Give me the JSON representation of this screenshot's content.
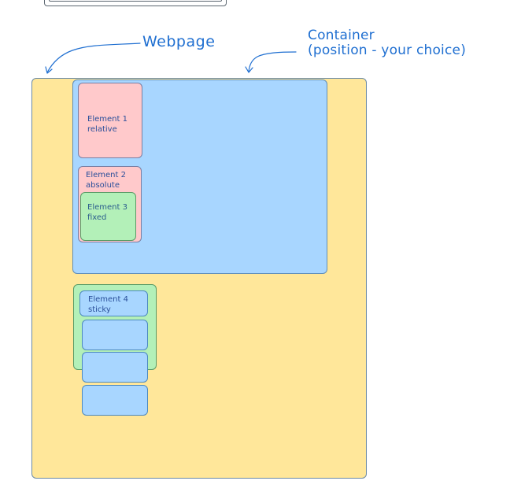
{
  "labels": {
    "webpage": "Webpage",
    "container": "Container\n(position - your choice)"
  },
  "elements": {
    "element1": "Element 1\nrelative",
    "element2": "Element 2\nabsolute",
    "element3": "Element 3\nfixed",
    "element4": "Element 4\nsticky"
  },
  "colors": {
    "webpage": "#ffe79a",
    "container": "#a8d6ff",
    "pink": "#ffc9cb",
    "green": "#b3f0b8",
    "blue": "#a8d6ff",
    "annotation": "#1f6fd1"
  }
}
